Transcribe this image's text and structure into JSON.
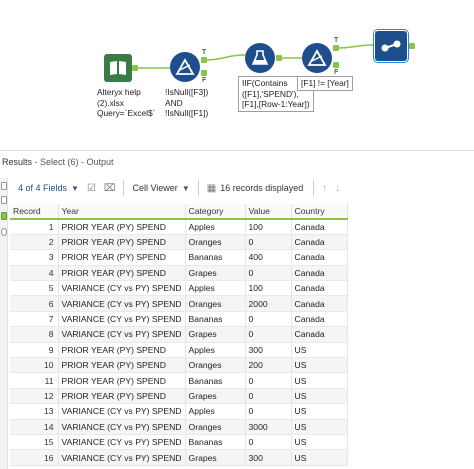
{
  "workflow": {
    "input_annotation": "Alteryx help\n(2).xlsx\nQuery=`Excel$`",
    "filter1_annotation": "!IsNull([F3])\nAND\n!IsNull([F1])",
    "formula_annotation": "IIF(Contains\n([F1],'SPEND'),\n[F1],[Row-1:Year])",
    "filter2_annotation": "[F1] != [Year]",
    "anchor_true": "T",
    "anchor_false": "F",
    "icons": {
      "input": "book-icon",
      "filter": "filter-triangle-icon",
      "formula": "flask-icon",
      "browse": "binoculars-icon"
    },
    "colors": {
      "tool_blue": "#1f4e8c",
      "input_green": "#3a7d44",
      "anchor_green": "#8bc34a"
    }
  },
  "results": {
    "title": "Results",
    "subtitle": " - Select (6) - Output",
    "fields_label": "4 of 4 Fields",
    "viewer_label": "Cell Viewer",
    "records_label": "16 records displayed"
  },
  "grid": {
    "columns": [
      "Record",
      "Year",
      "Category",
      "Value",
      "Country"
    ],
    "rows": [
      [
        "1",
        "PRIOR YEAR (PY) SPEND",
        "Apples",
        "100",
        "Canada"
      ],
      [
        "2",
        "PRIOR YEAR (PY) SPEND",
        "Oranges",
        "0",
        "Canada"
      ],
      [
        "3",
        "PRIOR YEAR (PY) SPEND",
        "Bananas",
        "400",
        "Canada"
      ],
      [
        "4",
        "PRIOR YEAR (PY) SPEND",
        "Grapes",
        "0",
        "Canada"
      ],
      [
        "5",
        "VARIANCE (CY vs PY) SPEND",
        "Apples",
        "100",
        "Canada"
      ],
      [
        "6",
        "VARIANCE (CY vs PY) SPEND",
        "Oranges",
        "2000",
        "Canada"
      ],
      [
        "7",
        "VARIANCE (CY vs PY) SPEND",
        "Bananas",
        "0",
        "Canada"
      ],
      [
        "8",
        "VARIANCE (CY vs PY) SPEND",
        "Grapes",
        "0",
        "Canada"
      ],
      [
        "9",
        "PRIOR YEAR (PY) SPEND",
        "Apples",
        "300",
        "US"
      ],
      [
        "10",
        "PRIOR YEAR (PY) SPEND",
        "Oranges",
        "200",
        "US"
      ],
      [
        "11",
        "PRIOR YEAR (PY) SPEND",
        "Bananas",
        "0",
        "US"
      ],
      [
        "12",
        "PRIOR YEAR (PY) SPEND",
        "Grapes",
        "0",
        "US"
      ],
      [
        "13",
        "VARIANCE (CY vs PY) SPEND",
        "Apples",
        "0",
        "US"
      ],
      [
        "14",
        "VARIANCE (CY vs PY) SPEND",
        "Oranges",
        "3000",
        "US"
      ],
      [
        "15",
        "VARIANCE (CY vs PY) SPEND",
        "Bananas",
        "0",
        "US"
      ],
      [
        "16",
        "VARIANCE (CY vs PY) SPEND",
        "Grapes",
        "300",
        "US"
      ]
    ]
  }
}
